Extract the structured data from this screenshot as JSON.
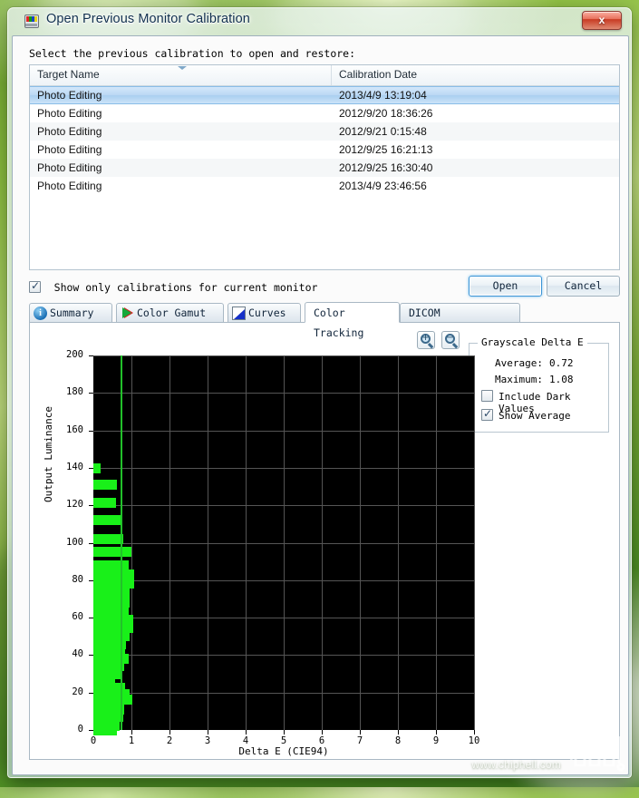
{
  "window": {
    "title": "Open Previous Monitor Calibration",
    "title_icon": "monitor-calibration-icon",
    "close_label": "x"
  },
  "instruction": "Select the previous calibration to open and restore:",
  "list": {
    "columns": [
      "Target Name",
      "Calibration Date"
    ],
    "rows": [
      {
        "name": "Photo Editing",
        "date": "2013/4/9 13:19:04",
        "selected": true
      },
      {
        "name": "Photo Editing",
        "date": "2012/9/20 18:36:26",
        "selected": false
      },
      {
        "name": "Photo Editing",
        "date": "2012/9/21 0:15:48",
        "selected": false
      },
      {
        "name": "Photo Editing",
        "date": "2012/9/25 16:21:13",
        "selected": false
      },
      {
        "name": "Photo Editing",
        "date": "2012/9/25 16:30:40",
        "selected": false
      },
      {
        "name": "Photo Editing",
        "date": "2013/4/9 23:46:56",
        "selected": false
      }
    ]
  },
  "options": {
    "show_only_current": {
      "label": "Show only calibrations for current monitor",
      "checked": true
    },
    "open_label": "Open",
    "cancel_label": "Cancel"
  },
  "tabs": [
    {
      "label": "Summary",
      "icon": "info-icon",
      "active": false
    },
    {
      "label": "Color Gamut",
      "icon": "gamut-triangle-icon",
      "active": false
    },
    {
      "label": "Curves",
      "icon": "curves-icon",
      "active": false
    },
    {
      "label": "Color Tracking",
      "icon": "",
      "active": true
    },
    {
      "label": "DICOM Conformance",
      "icon": "",
      "active": false
    }
  ],
  "toolbar": {
    "zoom_in": "zoom-in-icon",
    "zoom_out": "zoom-out-icon"
  },
  "grayscale_panel": {
    "title": "Grayscale Delta E",
    "average_label": "Average:",
    "average_value": "0.72",
    "maximum_label": "Maximum:",
    "maximum_value": "1.08",
    "include_dark": {
      "label": "Include Dark Values",
      "checked": false
    },
    "show_average": {
      "label": "Show Average",
      "checked": true
    }
  },
  "watermark": {
    "text": "www.chiphell.com",
    "logo": "chiphell-logo"
  },
  "chart_data": {
    "type": "bar",
    "orientation": "horizontal",
    "title": "",
    "xlabel": "Delta E (CIE94)",
    "ylabel": "Output Luminance",
    "xlim": [
      0,
      10
    ],
    "ylim": [
      0,
      200
    ],
    "xticks": [
      0,
      1,
      2,
      3,
      4,
      5,
      6,
      7,
      8,
      9,
      10
    ],
    "yticks": [
      0,
      20,
      40,
      60,
      80,
      100,
      120,
      140,
      160,
      180,
      200
    ],
    "grid": true,
    "plot_bg": "#000000",
    "bar_color": "#19f019",
    "average_line": {
      "value": 0.72,
      "color": "#22c12a",
      "label": "Show Average"
    },
    "categories": [
      139.5,
      131.0,
      121.5,
      112.0,
      102.0,
      95.0,
      88.0,
      83.0,
      78.0,
      73.0,
      68.0,
      63.5,
      59.0,
      54.5,
      50.0,
      46.0,
      42.0,
      38.0,
      34.0,
      30.0,
      26.0,
      22.5,
      19.0,
      16.0,
      12.5,
      8.5,
      4.0,
      1.5
    ],
    "values": [
      0.18,
      0.62,
      0.6,
      0.76,
      0.78,
      1.0,
      0.92,
      1.08,
      1.06,
      0.95,
      0.95,
      0.92,
      1.04,
      1.04,
      0.95,
      0.86,
      0.84,
      0.92,
      0.8,
      0.72,
      0.58,
      0.84,
      0.96,
      1.02,
      0.82,
      0.78,
      0.7,
      0.62
    ]
  }
}
